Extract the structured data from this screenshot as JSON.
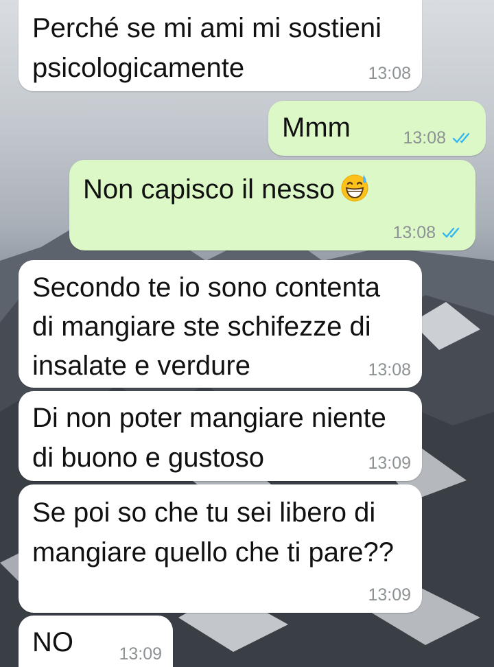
{
  "colors": {
    "incoming_bubble": "#ffffff",
    "outgoing_bubble": "#dcf8c6",
    "timestamp": "#8d9295",
    "read_ticks": "#34b7f1"
  },
  "messages": [
    {
      "direction": "incoming",
      "text": "Perché se mi ami mi sostieni\npsicologicamente",
      "time": "13:08"
    },
    {
      "direction": "outgoing",
      "text": "Mmm",
      "time": "13:08",
      "status": "read",
      "status_icon": "double-check-icon"
    },
    {
      "direction": "outgoing",
      "text": "Non capisco il nesso",
      "emoji": "grinning-face-with-sweat",
      "time": "13:08",
      "status": "read",
      "status_icon": "double-check-icon"
    },
    {
      "direction": "incoming",
      "text": "Secondo te io sono contenta\ndi mangiare ste schifezze di\ninsalate e verdure",
      "time": "13:08"
    },
    {
      "direction": "incoming",
      "text": "Di non poter mangiare niente\ndi buono e gustoso",
      "time": "13:09"
    },
    {
      "direction": "incoming",
      "text": "Se poi so che tu sei libero di\nmangiare quello che ti pare??",
      "time": "13:09"
    },
    {
      "direction": "incoming",
      "text": "NO",
      "time": "13:09"
    }
  ]
}
